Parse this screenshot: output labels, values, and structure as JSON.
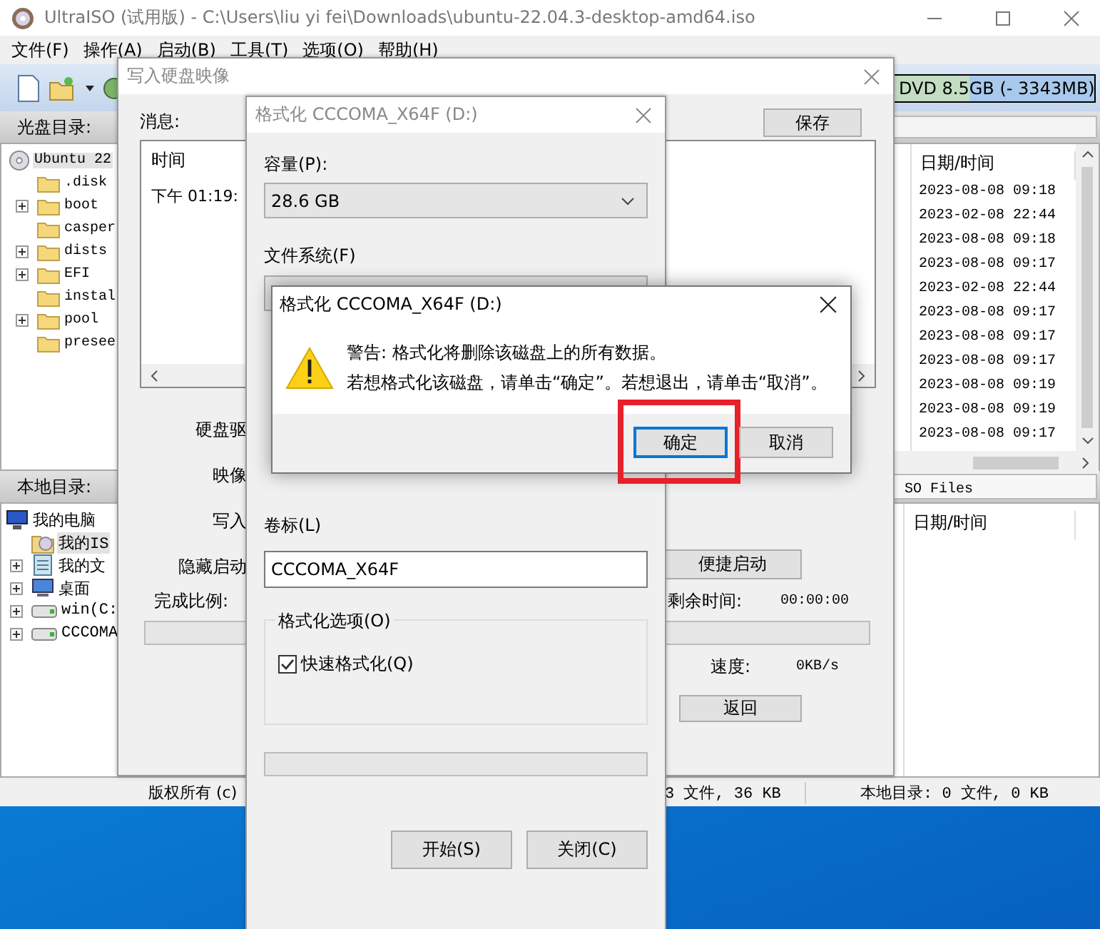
{
  "main_window": {
    "title": "UltraISO (试用版) - C:\\Users\\liu yi fei\\Downloads\\ubuntu-22.04.3-desktop-amd64.iso",
    "menu": [
      "文件(F)",
      "操作(A)",
      "启动(B)",
      "工具(T)",
      "选项(O)",
      "帮助(H)"
    ],
    "capacity": "DVD 8.5GB (- 3343MB)",
    "disc_dir_label": "光盘目录:",
    "disc_tree": {
      "label": "Ubuntu 22",
      "kind": "disc",
      "selected": true,
      "children": [
        {
          "label": ".disk",
          "kind": "folder",
          "expandable": false,
          "selected": false
        },
        {
          "label": "boot",
          "kind": "folder",
          "expandable": true,
          "selected": false
        },
        {
          "label": "casper",
          "kind": "folder",
          "expandable": false,
          "selected": false
        },
        {
          "label": "dists",
          "kind": "folder",
          "expandable": true,
          "selected": false
        },
        {
          "label": "EFI",
          "kind": "folder",
          "expandable": true,
          "selected": false
        },
        {
          "label": "instal",
          "kind": "folder",
          "expandable": false,
          "selected": false
        },
        {
          "label": "pool",
          "kind": "folder",
          "expandable": true,
          "selected": false
        },
        {
          "label": "presee",
          "kind": "folder",
          "expandable": false,
          "selected": false
        }
      ]
    },
    "disc_files": {
      "columns": [
        "日期/时间"
      ],
      "rows": [
        "2023-08-08 09:18",
        "2023-02-08 22:44",
        "2023-08-08 09:18",
        "2023-08-08 09:17",
        "2023-02-08 22:44",
        "2023-08-08 09:17",
        "2023-08-08 09:17",
        "2023-08-08 09:17",
        "2023-08-08 09:19",
        "2023-08-08 09:19",
        "2023-08-08 09:17"
      ]
    },
    "local_dir_label": "本地目录:",
    "local_path": "SO Files",
    "local_tree": {
      "label": "我的电脑",
      "kind": "computer",
      "selected": false,
      "children": [
        {
          "label": "我的IS",
          "kind": "iso-folder",
          "expandable": false,
          "selected": true
        },
        {
          "label": "我的文",
          "kind": "documents",
          "expandable": true,
          "selected": false
        },
        {
          "label": "桌面",
          "kind": "desktop",
          "expandable": true,
          "selected": false
        },
        {
          "label": "win(C:",
          "kind": "drive",
          "expandable": true,
          "selected": false
        },
        {
          "label": "CCCOMA",
          "kind": "drive",
          "expandable": true,
          "selected": false
        }
      ]
    },
    "local_files": {
      "columns": [
        "日期/时间"
      ]
    },
    "status_bar": [
      "版权所有 (c)",
      "3 文件, 36 KB",
      "本地目录: 0 文件, 0 KB"
    ]
  },
  "write_dialog": {
    "title": "写入硬盘映像",
    "message_label": "消息:",
    "save_button": "保存",
    "message_columns": [
      "时间"
    ],
    "message_rows": [
      "下午 01:19:"
    ],
    "field_labels": [
      "硬盘驱",
      "映像",
      "写入",
      "隐藏启动"
    ],
    "progress_label": "完成比例:",
    "progress": {
      "level": 0
    },
    "quick_boot_button": "便捷启动",
    "remaining_label": "剩余时间:",
    "remaining": "00:00:00",
    "speed_label": "速度:",
    "speed": "0KB/s",
    "back_button": "返回"
  },
  "format_dialog": {
    "title": "格式化 CCCOMA_X64F (D:)",
    "capacity_label": "容量(P):",
    "capacity": "28.6 GB",
    "filesystem_label": "文件系统(F)",
    "volume_label": "卷标(L)",
    "volume": "CCCOMA_X64F",
    "options_label": "格式化选项(O)",
    "quick_format": {
      "label": "快速格式化(Q)",
      "checked": true
    },
    "progress": {
      "level": 0
    },
    "buttons": [
      "开始(S)",
      "关闭(C)"
    ]
  },
  "message_box": {
    "title": "格式化 CCCOMA_X64F (D:)",
    "lines": [
      "警告: 格式化将删除该磁盘上的所有数据。",
      "若想格式化该磁盘，请单击“确定”。若想退出，请单击“取消”。"
    ],
    "buttons": [
      {
        "label": "确定",
        "focused": true,
        "highlighted": true
      },
      {
        "label": "取消",
        "focused": false,
        "highlighted": false
      }
    ]
  }
}
